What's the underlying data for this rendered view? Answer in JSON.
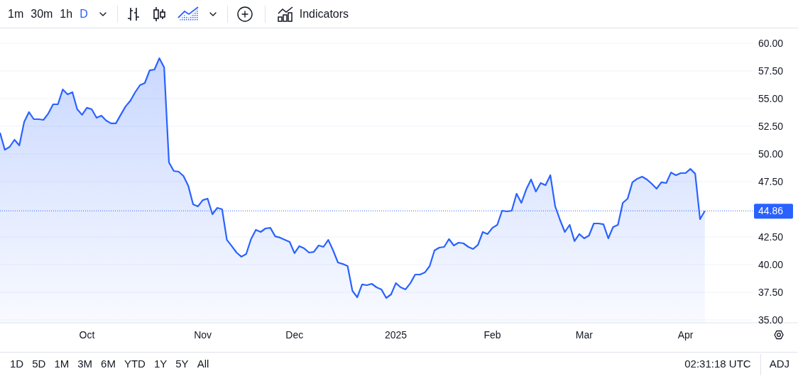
{
  "toolbar": {
    "intervals": [
      {
        "label": "1m",
        "selected": false
      },
      {
        "label": "30m",
        "selected": false
      },
      {
        "label": "1h",
        "selected": false
      },
      {
        "label": "D",
        "selected": true
      }
    ],
    "chart_types": [
      {
        "kind": "bars",
        "selected": false
      },
      {
        "kind": "candles",
        "selected": false
      },
      {
        "kind": "area",
        "selected": true
      }
    ],
    "indicators_label": "Indicators"
  },
  "chart": {
    "price_label": "44.86",
    "chart_data": {
      "type": "area",
      "grid": true,
      "ref_lines": [
        {
          "axis": "y",
          "value": 44.86,
          "color": "#2962ff"
        }
      ],
      "categories": [
        null,
        null,
        null,
        null,
        null,
        null,
        null,
        null,
        null,
        null,
        null,
        null,
        null,
        null,
        null,
        null,
        null,
        null,
        "Oct",
        null,
        null,
        null,
        null,
        null,
        null,
        null,
        null,
        null,
        null,
        null,
        null,
        null,
        null,
        null,
        null,
        null,
        null,
        null,
        null,
        null,
        null,
        null,
        "Nov",
        null,
        null,
        null,
        null,
        null,
        null,
        null,
        null,
        null,
        null,
        null,
        null,
        null,
        null,
        null,
        null,
        null,
        null,
        "Dec",
        null,
        null,
        null,
        null,
        null,
        null,
        null,
        null,
        null,
        null,
        null,
        null,
        null,
        null,
        null,
        null,
        null,
        null,
        null,
        null,
        "2025",
        null,
        null,
        null,
        null,
        null,
        null,
        null,
        null,
        null,
        null,
        null,
        null,
        null,
        null,
        null,
        null,
        null,
        null,
        null,
        "Feb",
        null,
        null,
        null,
        null,
        null,
        null,
        null,
        null,
        null,
        null,
        null,
        null,
        null,
        null,
        null,
        null,
        null,
        null,
        "Mar",
        null,
        null,
        null,
        null,
        null,
        null,
        null,
        null,
        null,
        null,
        null,
        null,
        null,
        null,
        null,
        null,
        null,
        null,
        null,
        null,
        "Apr",
        null,
        null,
        null,
        null
      ],
      "series": [
        {
          "color": "#2962ff",
          "values": [
            51.92,
            50.38,
            50.64,
            51.28,
            50.77,
            52.88,
            53.78,
            53.14,
            53.14,
            53.08,
            53.65,
            54.49,
            54.49,
            55.83,
            55.38,
            55.58,
            54.04,
            53.53,
            54.17,
            54.04,
            53.27,
            53.46,
            53.01,
            52.76,
            52.76,
            53.53,
            54.29,
            54.81,
            55.58,
            56.22,
            56.41,
            57.56,
            57.63,
            58.65,
            57.82,
            49.23,
            48.46,
            48.4,
            48.01,
            47.12,
            45.45,
            45.26,
            45.83,
            45.96,
            44.55,
            45.13,
            45.0,
            42.24,
            41.67,
            41.09,
            40.71,
            40.96,
            42.31,
            43.14,
            42.95,
            43.27,
            43.33,
            42.56,
            42.44,
            42.24,
            42.05,
            41.03,
            41.67,
            41.47,
            41.09,
            41.15,
            41.73,
            41.6,
            42.24,
            41.28,
            40.19,
            40.06,
            39.87,
            37.63,
            37.05,
            38.21,
            38.14,
            38.27,
            37.95,
            37.76,
            36.99,
            37.31,
            38.33,
            37.95,
            37.76,
            38.33,
            39.1,
            39.1,
            39.29,
            39.87,
            41.28,
            41.54,
            41.6,
            42.31,
            41.73,
            41.99,
            41.92,
            41.6,
            41.41,
            41.79,
            42.95,
            42.76,
            43.33,
            43.59,
            44.87,
            44.81,
            44.87,
            46.41,
            45.58,
            46.79,
            47.69,
            46.6,
            47.37,
            47.18,
            48.08,
            45.26,
            44.04,
            42.95,
            43.59,
            42.12,
            42.76,
            42.37,
            42.63,
            43.72,
            43.72,
            43.65,
            42.37,
            43.4,
            43.59,
            45.58,
            45.96,
            47.44,
            47.76,
            47.95,
            47.69,
            47.31,
            46.86,
            47.44,
            47.37,
            48.33,
            48.08,
            48.27,
            48.27,
            48.65,
            48.21,
            44.1,
            44.86
          ]
        }
      ],
      "ylim": [
        35,
        60
      ],
      "yticks": [
        {
          "value": 60,
          "label": "60.00"
        },
        {
          "value": 57.5,
          "label": "57.50"
        },
        {
          "value": 55,
          "label": "55.00"
        },
        {
          "value": 52.5,
          "label": "52.50"
        },
        {
          "value": 50,
          "label": "50.00"
        },
        {
          "value": 47.5,
          "label": "47.50"
        },
        {
          "value": 42.5,
          "label": "42.50"
        },
        {
          "value": 40,
          "label": "40.00"
        },
        {
          "value": 37.5,
          "label": "37.50"
        },
        {
          "value": 35,
          "label": "35.00"
        }
      ]
    }
  },
  "range_buttons": [
    "1D",
    "5D",
    "1M",
    "3M",
    "6M",
    "YTD",
    "1Y",
    "5Y",
    "All"
  ],
  "time": "02:31:18 UTC",
  "adj": "ADJ"
}
